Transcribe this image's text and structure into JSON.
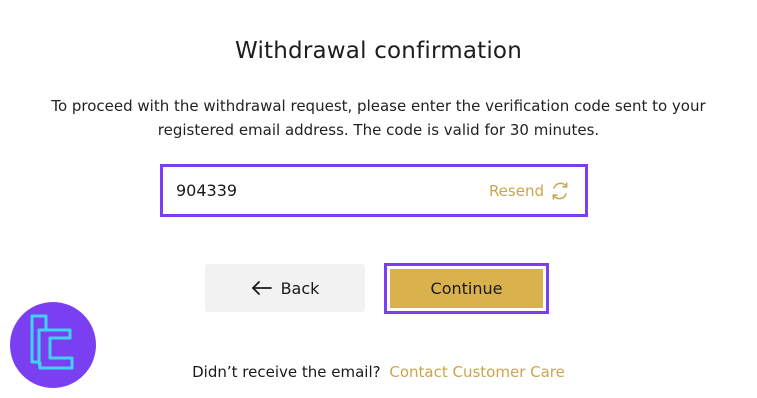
{
  "page": {
    "title": "Withdrawal confirmation",
    "description": "To proceed with the withdrawal request, please enter the verification code sent to your registered email address. The code is valid for 30 minutes."
  },
  "code_field": {
    "value": "904339",
    "resend_label": "Resend",
    "resend_icon": "refresh-icon"
  },
  "actions": {
    "back_label": "Back",
    "back_icon": "arrow-left-icon",
    "continue_label": "Continue"
  },
  "footer": {
    "prompt": "Didn’t receive the email?",
    "link": "Contact Customer Care"
  },
  "colors": {
    "accent_gold": "#d9b24e",
    "link_gold": "#c9a64d",
    "highlight_purple": "#7b3ff2"
  }
}
